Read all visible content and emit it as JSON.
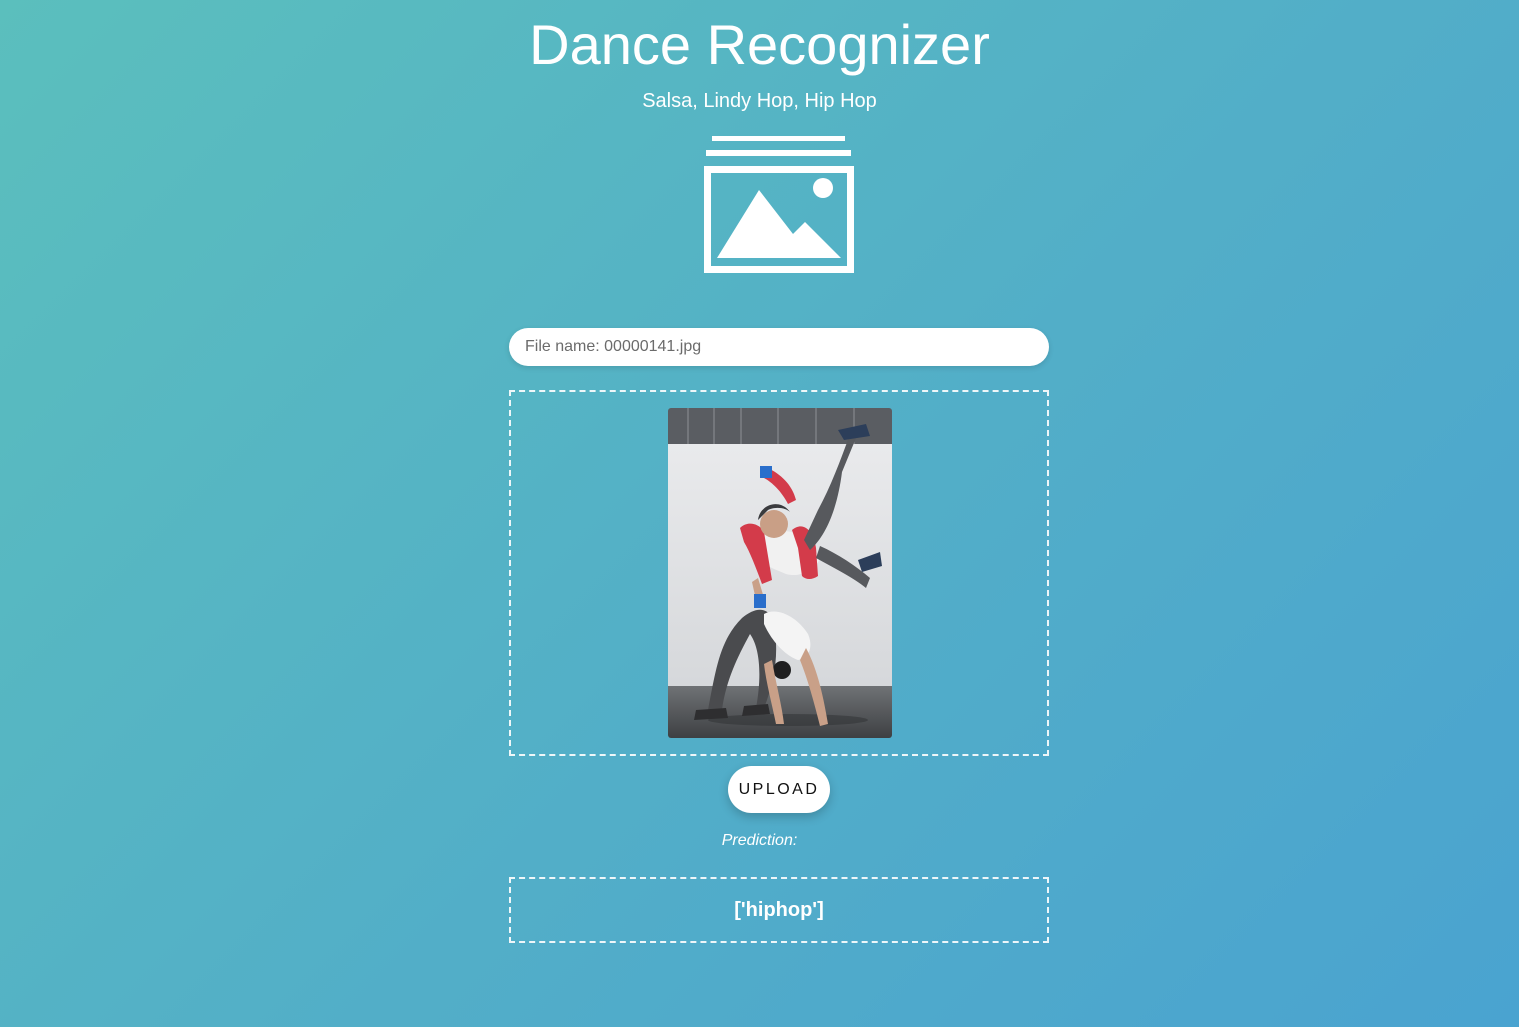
{
  "header": {
    "title": "Dance Recognizer",
    "subtitle": "Salsa, Lindy Hop, Hip Hop",
    "icon": "image-gallery-icon"
  },
  "upload_form": {
    "file_field": {
      "placeholder": "File name: 00000141.jpg",
      "value": ""
    },
    "preview": {
      "description": "hip hop dancers photo"
    },
    "upload_label": "UPLOAD"
  },
  "prediction": {
    "label": "Prediction:",
    "result": "['hiphop']"
  },
  "colors": {
    "background_start": "#5bbfbd",
    "background_end": "#4aa3d0",
    "text": "#ffffff",
    "button_bg": "#ffffff",
    "button_text": "#111111"
  }
}
